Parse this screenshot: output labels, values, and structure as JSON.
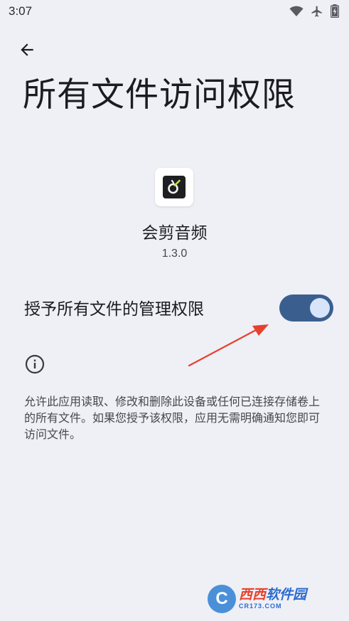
{
  "status_bar": {
    "time": "3:07",
    "icons": [
      "wifi-icon",
      "airplane-icon",
      "battery-charging-icon"
    ]
  },
  "header": {
    "back_icon": "arrow-back-icon",
    "title": "所有文件访问权限"
  },
  "app": {
    "name": "会剪音频",
    "version": "1.3.0",
    "icon": "app-icon"
  },
  "permission": {
    "label": "授予所有文件的管理权限",
    "enabled": true,
    "toggle_color": "#3a5f8f",
    "knob_color": "#d8e4fa"
  },
  "info": {
    "icon": "info-icon",
    "text": "允许此应用读取、修改和删除此设备或任何已连接存储卷上的所有文件。如果您授予该权限，应用无需明确通知您即可访问文件。"
  },
  "annotation": {
    "arrow_color": "#e5412d"
  },
  "watermark": {
    "logo_letter": "C",
    "brand_a": "西西",
    "brand_b": "软件园",
    "domain": "CR173.COM"
  }
}
